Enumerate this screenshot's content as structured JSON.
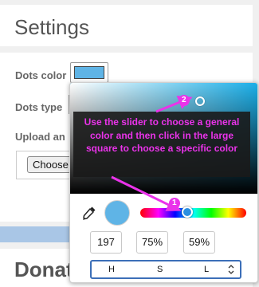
{
  "settings": {
    "title": "Settings",
    "dots_color_label": "Dots color",
    "dots_type_label": "Dots type",
    "upload_label": "Upload an",
    "choose_file_label": "Choose",
    "dots_color_value": "#5fb4e6"
  },
  "donate": {
    "title": "Donat"
  },
  "color_picker": {
    "base_hue_color": "#19aee8",
    "preview_color": "#5fb4e6",
    "hue_value": "197",
    "saturation_value": "75%",
    "lightness_value": "59%",
    "mode_labels": {
      "h": "H",
      "s": "S",
      "l": "L"
    },
    "mode_toggle_icon": "⌃⌄",
    "eyedropper_icon": "eyedropper-icon"
  },
  "tutorial": {
    "text": "Use the slider to choose a general color and then click in the large square to choose a specific color",
    "step_1": "1",
    "step_2": "2",
    "accent_color": "#ea33ea"
  }
}
